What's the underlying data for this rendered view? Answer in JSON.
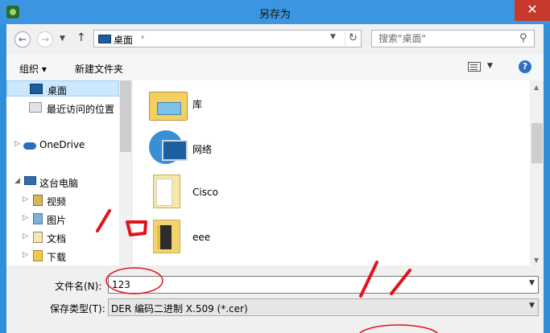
{
  "window": {
    "title": "另存为",
    "close_symbol": "✕"
  },
  "nav_buttons": {
    "back": "←",
    "forward": "→",
    "recent": "▼",
    "up": "↑"
  },
  "address": {
    "location": "桌面",
    "separator": "›",
    "dropdown": "▼",
    "refresh": "↻"
  },
  "search": {
    "placeholder": "搜索\"桌面\"",
    "icon": "⚲"
  },
  "toolbar": {
    "organize_label": "组织 ▾",
    "new_folder_label": "新建文件夹",
    "view_dropdown": "▼",
    "help_symbol": "?"
  },
  "sidebar": {
    "items": [
      {
        "label": "桌面",
        "icon": "desktop-icon"
      },
      {
        "label": "最近访问的位置",
        "icon": "recent-places-icon"
      },
      {
        "label": "OneDrive",
        "icon": "onedrive-icon",
        "expander": "▷"
      },
      {
        "label": "这台电脑",
        "icon": "this-pc-icon",
        "expander": "◢"
      },
      {
        "label": "视频",
        "icon": "videos-icon",
        "expander": "▷"
      },
      {
        "label": "图片",
        "icon": "pictures-icon",
        "expander": "▷"
      },
      {
        "label": "文档",
        "icon": "documents-icon",
        "expander": "▷"
      },
      {
        "label": "下载",
        "icon": "downloads-icon",
        "expander": "▷"
      }
    ]
  },
  "files": {
    "items": [
      {
        "name": "库",
        "icon": "libraries-icon"
      },
      {
        "name": "网络",
        "icon": "network-icon"
      },
      {
        "name": "Cisco",
        "icon": "folder-icon"
      },
      {
        "name": "eee",
        "icon": "folder-icon"
      }
    ]
  },
  "form": {
    "filename_label": "文件名(N):",
    "filename_value": "123",
    "dropdown": "▼",
    "type_label": "保存类型(T):",
    "type_value": "DER 编码二进制 X.509 (*.cer)"
  },
  "colors": {
    "annotation": "#e3121b",
    "titlebar": "#3c95e0",
    "close": "#c7392c",
    "selection": "#cce8ff"
  }
}
